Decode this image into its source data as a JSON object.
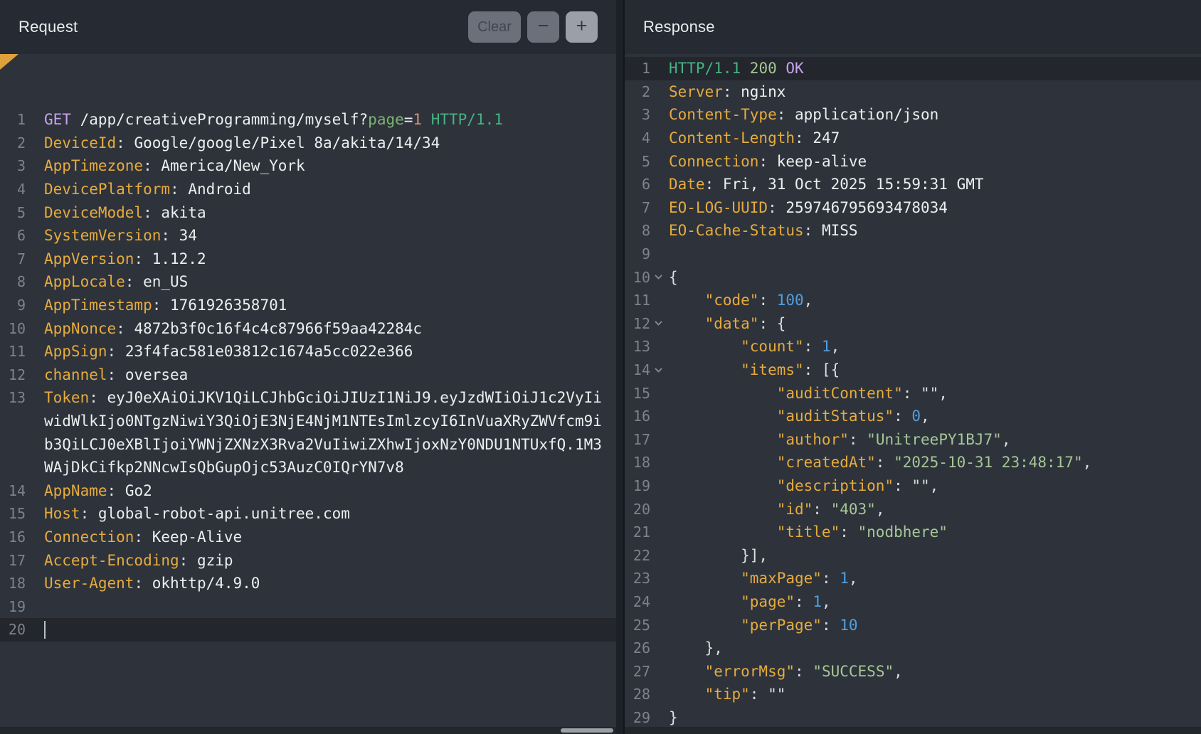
{
  "request_panel": {
    "title": "Request",
    "buttons": {
      "clear": "Clear",
      "decrease": "−",
      "increase": "+"
    },
    "lines": [
      {
        "n": "1",
        "t": [
          [
            "meth",
            "GET"
          ],
          [
            "val",
            " /app/creativeProgramming/myself?"
          ],
          [
            "qkey",
            "page"
          ],
          [
            "val",
            "="
          ],
          [
            "onum",
            "1"
          ],
          [
            "http",
            " HTTP/1.1"
          ]
        ]
      },
      {
        "n": "2",
        "t": [
          [
            "key",
            "DeviceId"
          ],
          [
            "punct",
            ": "
          ],
          [
            "val",
            "Google/google/Pixel 8a/akita/14/34"
          ]
        ]
      },
      {
        "n": "3",
        "t": [
          [
            "key",
            "AppTimezone"
          ],
          [
            "punct",
            ": "
          ],
          [
            "val",
            "America/New_York"
          ]
        ]
      },
      {
        "n": "4",
        "t": [
          [
            "key",
            "DevicePlatform"
          ],
          [
            "punct",
            ": "
          ],
          [
            "val",
            "Android"
          ]
        ]
      },
      {
        "n": "5",
        "t": [
          [
            "key",
            "DeviceModel"
          ],
          [
            "punct",
            ": "
          ],
          [
            "val",
            "akita"
          ]
        ]
      },
      {
        "n": "6",
        "t": [
          [
            "key",
            "SystemVersion"
          ],
          [
            "punct",
            ": "
          ],
          [
            "val",
            "34"
          ]
        ]
      },
      {
        "n": "7",
        "t": [
          [
            "key",
            "AppVersion"
          ],
          [
            "punct",
            ": "
          ],
          [
            "val",
            "1.12.2"
          ]
        ]
      },
      {
        "n": "8",
        "t": [
          [
            "key",
            "AppLocale"
          ],
          [
            "punct",
            ": "
          ],
          [
            "val",
            "en_US"
          ]
        ]
      },
      {
        "n": "9",
        "t": [
          [
            "key",
            "AppTimestamp"
          ],
          [
            "punct",
            ": "
          ],
          [
            "val",
            "1761926358701"
          ]
        ]
      },
      {
        "n": "10",
        "t": [
          [
            "key",
            "AppNonce"
          ],
          [
            "punct",
            ": "
          ],
          [
            "val",
            "4872b3f0c16f4c4c87966f59aa42284c"
          ]
        ]
      },
      {
        "n": "11",
        "t": [
          [
            "key",
            "AppSign"
          ],
          [
            "punct",
            ": "
          ],
          [
            "val",
            "23f4fac581e03812c1674a5cc022e366"
          ]
        ]
      },
      {
        "n": "12",
        "t": [
          [
            "key",
            "channel"
          ],
          [
            "punct",
            ": "
          ],
          [
            "val",
            "oversea"
          ]
        ]
      },
      {
        "n": "13",
        "t": [
          [
            "key",
            "Token"
          ],
          [
            "punct",
            ": "
          ],
          [
            "val",
            "eyJ0eXAiOiJKV1QiLCJhbGciOiJIUzI1NiJ9.eyJzdWIiOiJ1c2VyIi"
          ]
        ]
      },
      {
        "n": "",
        "t": [
          [
            "val",
            "widWlkIjo0NTgzNiwiY3QiOjE3NjE4NjM1NTEsImlzcyI6InVuaXRyZWVfcm9i"
          ]
        ]
      },
      {
        "n": "",
        "t": [
          [
            "val",
            "b3QiLCJ0eXBlIjoiYWNjZXNzX3Rva2VuIiwiZXhwIjoxNzY0NDU1NTUxfQ.1M3"
          ]
        ]
      },
      {
        "n": "",
        "t": [
          [
            "val",
            "WAjDkCifkp2NNcwIsQbGupOjc53AuzC0IQrYN7v8"
          ]
        ]
      },
      {
        "n": "14",
        "t": [
          [
            "key",
            "AppName"
          ],
          [
            "punct",
            ": "
          ],
          [
            "val",
            "Go2"
          ]
        ]
      },
      {
        "n": "15",
        "t": [
          [
            "key",
            "Host"
          ],
          [
            "punct",
            ": "
          ],
          [
            "val",
            "global-robot-api.unitree.com"
          ]
        ]
      },
      {
        "n": "16",
        "t": [
          [
            "key",
            "Connection"
          ],
          [
            "punct",
            ": "
          ],
          [
            "val",
            "Keep-Alive"
          ]
        ]
      },
      {
        "n": "17",
        "t": [
          [
            "key",
            "Accept-Encoding"
          ],
          [
            "punct",
            ": "
          ],
          [
            "val",
            "gzip"
          ]
        ]
      },
      {
        "n": "18",
        "t": [
          [
            "key",
            "User-Agent"
          ],
          [
            "punct",
            ": "
          ],
          [
            "val",
            "okhttp/4.9.0"
          ]
        ]
      },
      {
        "n": "19",
        "t": []
      },
      {
        "n": "20",
        "t": [],
        "hl": true,
        "cursor": true
      }
    ]
  },
  "response_panel": {
    "title": "Response",
    "lines": [
      {
        "n": "1",
        "hl": true,
        "t": [
          [
            "http",
            "HTTP/1.1"
          ],
          [
            "pale",
            " 200"
          ],
          [
            "ok",
            " OK"
          ]
        ]
      },
      {
        "n": "2",
        "t": [
          [
            "key",
            "Server"
          ],
          [
            "punct",
            ": "
          ],
          [
            "val",
            "nginx"
          ]
        ]
      },
      {
        "n": "3",
        "t": [
          [
            "key",
            "Content-Type"
          ],
          [
            "punct",
            ": "
          ],
          [
            "val",
            "application/json"
          ]
        ]
      },
      {
        "n": "4",
        "t": [
          [
            "key",
            "Content-Length"
          ],
          [
            "punct",
            ": "
          ],
          [
            "val",
            "247"
          ]
        ]
      },
      {
        "n": "5",
        "t": [
          [
            "key",
            "Connection"
          ],
          [
            "punct",
            ": "
          ],
          [
            "val",
            "keep-alive"
          ]
        ]
      },
      {
        "n": "6",
        "t": [
          [
            "key",
            "Date"
          ],
          [
            "punct",
            ": "
          ],
          [
            "val",
            "Fri, 31 Oct 2025 15:59:31 GMT"
          ]
        ]
      },
      {
        "n": "7",
        "t": [
          [
            "key",
            "EO-LOG-UUID"
          ],
          [
            "punct",
            ": "
          ],
          [
            "val",
            "259746795693478034"
          ]
        ]
      },
      {
        "n": "8",
        "t": [
          [
            "key",
            "EO-Cache-Status"
          ],
          [
            "punct",
            ": "
          ],
          [
            "val",
            "MISS"
          ]
        ]
      },
      {
        "n": "9",
        "t": []
      },
      {
        "n": "10",
        "fold": true,
        "t": [
          [
            "punct",
            "{"
          ]
        ]
      },
      {
        "n": "11",
        "t": [
          [
            "jkey",
            "    \"code\""
          ],
          [
            "punct",
            ": "
          ],
          [
            "blue",
            "100"
          ],
          [
            "punct",
            ","
          ]
        ]
      },
      {
        "n": "12",
        "fold": true,
        "t": [
          [
            "jkey",
            "    \"data\""
          ],
          [
            "punct",
            ": {"
          ]
        ]
      },
      {
        "n": "13",
        "t": [
          [
            "jkey",
            "        \"count\""
          ],
          [
            "punct",
            ": "
          ],
          [
            "blue",
            "1"
          ],
          [
            "punct",
            ","
          ]
        ]
      },
      {
        "n": "14",
        "fold": true,
        "t": [
          [
            "jkey",
            "        \"items\""
          ],
          [
            "punct",
            ": [{"
          ]
        ]
      },
      {
        "n": "15",
        "t": [
          [
            "jkey",
            "            \"auditContent\""
          ],
          [
            "punct",
            ": \"\","
          ]
        ]
      },
      {
        "n": "16",
        "t": [
          [
            "jkey",
            "            \"auditStatus\""
          ],
          [
            "punct",
            ": "
          ],
          [
            "blue",
            "0"
          ],
          [
            "punct",
            ","
          ]
        ]
      },
      {
        "n": "17",
        "t": [
          [
            "jkey",
            "            \"author\""
          ],
          [
            "punct",
            ": "
          ],
          [
            "pale",
            "\"UnitreePY1BJ7\""
          ],
          [
            "punct",
            ","
          ]
        ]
      },
      {
        "n": "18",
        "t": [
          [
            "jkey",
            "            \"createdAt\""
          ],
          [
            "punct",
            ": "
          ],
          [
            "pale",
            "\"2025-10-31 23:48:17\""
          ],
          [
            "punct",
            ","
          ]
        ]
      },
      {
        "n": "19",
        "t": [
          [
            "jkey",
            "            \"description\""
          ],
          [
            "punct",
            ": \"\","
          ]
        ]
      },
      {
        "n": "20",
        "t": [
          [
            "jkey",
            "            \"id\""
          ],
          [
            "punct",
            ": "
          ],
          [
            "pale",
            "\"403\""
          ],
          [
            "punct",
            ","
          ]
        ]
      },
      {
        "n": "21",
        "t": [
          [
            "jkey",
            "            \"title\""
          ],
          [
            "punct",
            ": "
          ],
          [
            "pale",
            "\"nodbhere\""
          ]
        ]
      },
      {
        "n": "22",
        "t": [
          [
            "punct",
            "        }],"
          ]
        ]
      },
      {
        "n": "23",
        "t": [
          [
            "jkey",
            "        \"maxPage\""
          ],
          [
            "punct",
            ": "
          ],
          [
            "blue",
            "1"
          ],
          [
            "punct",
            ","
          ]
        ]
      },
      {
        "n": "24",
        "t": [
          [
            "jkey",
            "        \"page\""
          ],
          [
            "punct",
            ": "
          ],
          [
            "blue",
            "1"
          ],
          [
            "punct",
            ","
          ]
        ]
      },
      {
        "n": "25",
        "t": [
          [
            "jkey",
            "        \"perPage\""
          ],
          [
            "punct",
            ": "
          ],
          [
            "blue",
            "10"
          ]
        ]
      },
      {
        "n": "26",
        "t": [
          [
            "punct",
            "    },"
          ]
        ]
      },
      {
        "n": "27",
        "t": [
          [
            "jkey",
            "    \"errorMsg\""
          ],
          [
            "punct",
            ": "
          ],
          [
            "pale",
            "\"SUCCESS\""
          ],
          [
            "punct",
            ","
          ]
        ]
      },
      {
        "n": "28",
        "t": [
          [
            "jkey",
            "    \"tip\""
          ],
          [
            "punct",
            ": \"\""
          ]
        ]
      },
      {
        "n": "29",
        "t": [
          [
            "punct",
            "}"
          ]
        ]
      }
    ]
  }
}
